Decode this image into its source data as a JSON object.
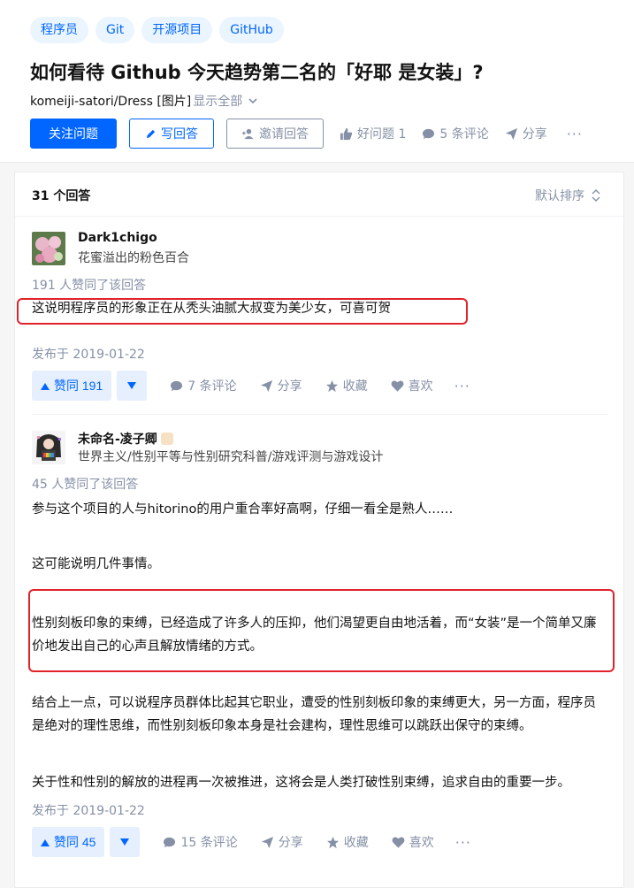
{
  "tags": [
    "程序员",
    "Git",
    "开源项目",
    "GitHub"
  ],
  "question": {
    "title": "如何看待 Github 今天趋势第二名的「好耶 是女装」?",
    "detail": "komeiji-satori/Dress [图片]",
    "show_all": "显示全部"
  },
  "actions": {
    "follow": "关注问题",
    "write": "写回答",
    "invite": "邀请回答",
    "good_question": "好问题 1",
    "comments": "5 条评论",
    "share": "分享",
    "more": "···"
  },
  "answers_header": {
    "count": "31 个回答",
    "sort": "默认排序"
  },
  "answers": [
    {
      "author": "Dark1chigo",
      "bio": "花蜜溢出的粉色百合",
      "voters": "191 人赞同了该回答",
      "paragraphs": [
        "这说明程序员的形象正在从秃头油腻大叔变为美少女，可喜可贺"
      ],
      "published": "发布于 2019-01-22",
      "vote": "赞同 191",
      "comments": "7 条评论",
      "share": "分享",
      "collect": "收藏",
      "like": "喜欢",
      "more": "···"
    },
    {
      "author": "未命名-凌子卿",
      "bio": "世界主义/性别平等与性别研究科普/游戏评测与游戏设计",
      "voters": "45 人赞同了该回答",
      "paragraphs": [
        "参与这个项目的人与hitorino的用户重合率好高啊，仔细一看全是熟人……",
        "这可能说明几件事情。",
        "性别刻板印象的束缚，已经造成了许多人的压抑，他们渴望更自由地活着，而“女装”是一个简单又廉价地发出自己的心声且解放情绪的方式。",
        "结合上一点，可以说程序员群体比起其它职业，遭受的性别刻板印象的束缚更大，另一方面，程序员是绝对的理性思维，而性别刻板印象本身是社会建构，理性思维可以跳跃出保守的束缚。",
        "关于性和性别的解放的进程再一次被推进，这将会是人类打破性别束缚，追求自由的重要一步。"
      ],
      "published": "发布于 2019-01-22",
      "vote": "赞同 45",
      "comments": "15 条评论",
      "share": "分享",
      "collect": "收藏",
      "like": "喜欢",
      "more": "···"
    }
  ],
  "colors": {
    "brand": "#0066ff",
    "highlight_box": "#e0232b",
    "muted": "#8590a6"
  }
}
